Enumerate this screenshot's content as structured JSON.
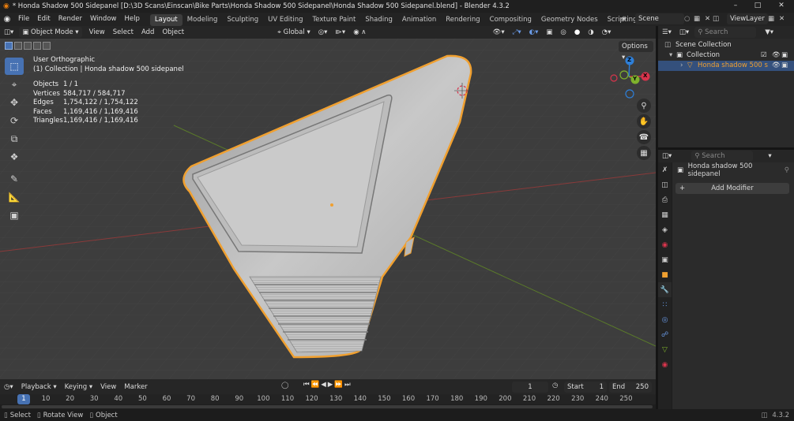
{
  "titlebar": {
    "title": "* Honda Shadow 500 Sidepanel [D:\\3D Scans\\Einscan\\Bike Parts\\Honda Shadow 500 Sidepanel\\Honda Shadow 500 Sidepanel.blend] - Blender 4.3.2"
  },
  "menu": {
    "file": "File",
    "edit": "Edit",
    "render": "Render",
    "window": "Window",
    "help": "Help"
  },
  "workspaces": [
    {
      "label": "Layout"
    },
    {
      "label": "Modeling"
    },
    {
      "label": "Sculpting"
    },
    {
      "label": "UV Editing"
    },
    {
      "label": "Texture Paint"
    },
    {
      "label": "Shading"
    },
    {
      "label": "Animation"
    },
    {
      "label": "Rendering"
    },
    {
      "label": "Compositing"
    },
    {
      "label": "Geometry Nodes"
    },
    {
      "label": "Scripting"
    }
  ],
  "scene": {
    "name": "Scene",
    "view_layer": "ViewLayer"
  },
  "viewport_header": {
    "mode": "Object Mode",
    "view": "View",
    "select": "Select",
    "add": "Add",
    "object": "Object",
    "transform": "Global",
    "options": "Options"
  },
  "overlay": {
    "view_name": "User Orthographic",
    "collection_line": "(1) Collection | Honda shadow 500 sidepanel",
    "stats": [
      {
        "label": "Objects",
        "value": "1 / 1"
      },
      {
        "label": "Vertices",
        "value": "584,717 / 584,717"
      },
      {
        "label": "Edges",
        "value": "1,754,122 / 1,754,122"
      },
      {
        "label": "Faces",
        "value": "1,169,416 / 1,169,416"
      },
      {
        "label": "Triangles",
        "value": "1,169,416 / 1,169,416"
      }
    ]
  },
  "gizmo": {
    "x": "X",
    "y": "Y",
    "z": "Z"
  },
  "timeline": {
    "playback": "Playback",
    "keying": "Keying",
    "view": "View",
    "marker": "Marker",
    "current_frame": "1",
    "start_label": "Start",
    "start": "1",
    "end_label": "End",
    "end": "250"
  },
  "ruler": [
    "1",
    "10",
    "20",
    "30",
    "40",
    "50",
    "60",
    "70",
    "80",
    "90",
    "100",
    "110",
    "120",
    "130",
    "140",
    "150",
    "160",
    "170",
    "180",
    "190",
    "200",
    "210",
    "220",
    "230",
    "240",
    "250"
  ],
  "outliner": {
    "search_placeholder": "Search",
    "scene_collection": "Scene Collection",
    "collection": "Collection",
    "object": "Honda shadow 500 s"
  },
  "properties": {
    "search_placeholder": "Search",
    "object_name": "Honda shadow 500 sidepanel",
    "add_modifier": "Add Modifier"
  },
  "statusbar": {
    "select": "Select",
    "rotate": "Rotate View",
    "object": "Object",
    "version": "4.3.2"
  },
  "colors": {
    "accent": "#4772b3",
    "selection_outline": "#f0a030",
    "axis_x": "#d8344c",
    "axis_y": "#7fb22c",
    "axis_z": "#2e7fd8"
  }
}
